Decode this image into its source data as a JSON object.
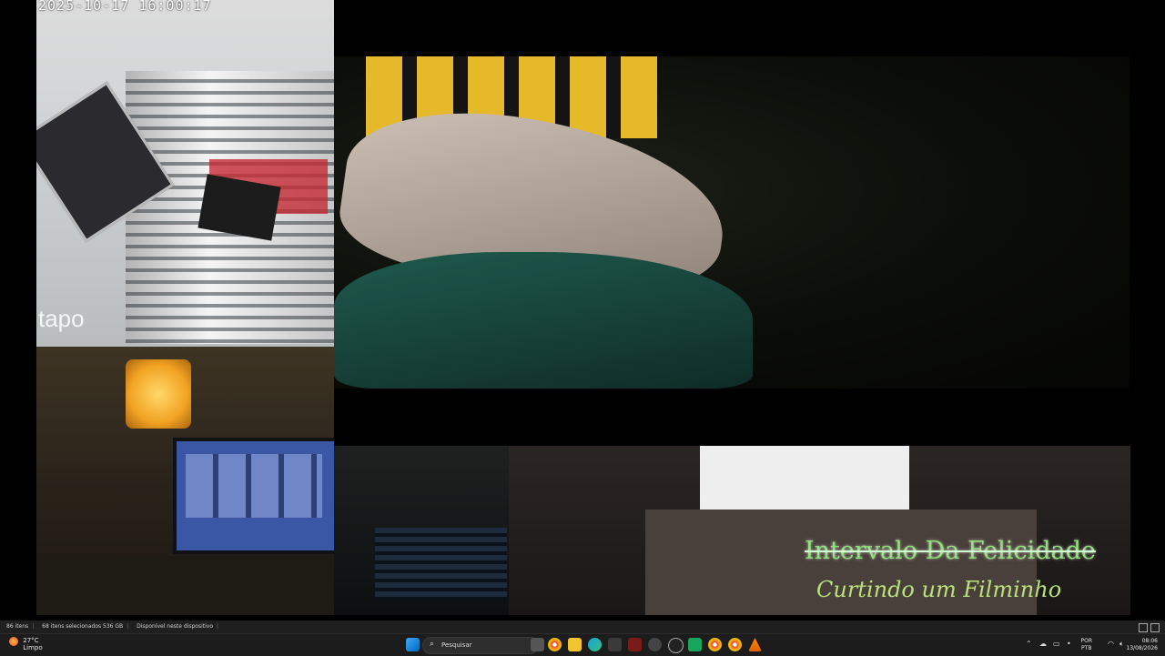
{
  "camera_top_left": {
    "timestamp": "2025-10-17 16:00:17",
    "logo_text": "tapo"
  },
  "overlay": {
    "title": "Intervalo Da Felicidade",
    "subtitle": "Curtindo um Filminho"
  },
  "explorer_status": {
    "items_count": "86 itens",
    "selected": "68 itens selecionados  536 GB",
    "availability": "Disponível neste dispositivo"
  },
  "taskbar": {
    "weather_temp": "27°C",
    "weather_desc": "Limpo",
    "search_placeholder": "Pesquisar",
    "lang_top": "POR",
    "lang_bottom": "PTB",
    "time": "08:06",
    "date": "13/08/2026",
    "colors": {
      "chrome": "#e9453b",
      "edge": "#1a9fe0",
      "folder": "#f4c430",
      "accent_green": "#90e27a"
    }
  }
}
